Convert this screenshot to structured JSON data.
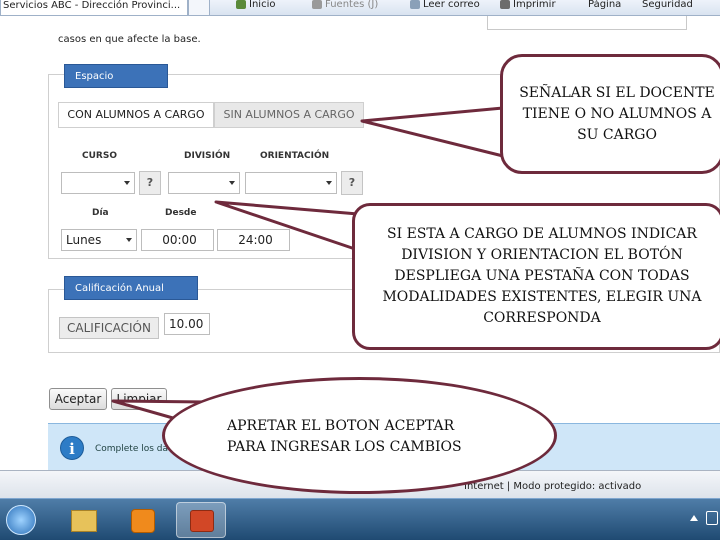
{
  "browser": {
    "tab_title": "Servicios ABC - Dirección Provinci...",
    "toolbar": {
      "home": "Inicio",
      "feeds": "Fuentes (J)",
      "read_mail": "Leer correo",
      "print": "Imprimir",
      "page": "Página",
      "safety": "Seguridad"
    }
  },
  "page": {
    "note": "casos en que afecte la base."
  },
  "academic_panel": {
    "title": "Espacio Académico:",
    "tabs": [
      "CON ALUMNOS A CARGO",
      "SIN ALUMNOS A CARGO"
    ],
    "labels": {
      "curso": "CURSO",
      "division": "DIVISIÓN",
      "orientacion": "ORIENTACIÓN",
      "dia": "Día",
      "desde": "Desde"
    },
    "help_glyph": "?",
    "dia_value": "Lunes",
    "desde_value": "00:00",
    "hasta_value": "24:00"
  },
  "rating_panel": {
    "title": "Calificación Anual Docente:",
    "label": "CALIFICACIÓN",
    "value": "10.00"
  },
  "buttons": {
    "accept": "Aceptar",
    "clean": "Limpiar"
  },
  "info_bar": {
    "text": "Complete los datos",
    "icon_glyph": "i"
  },
  "statusbar": {
    "zone": "Internet | Modo protegido: activado"
  },
  "callouts": {
    "top": "SEÑALAR SI EL DOCENTE TIENE O NO ALUMNOS A SU CARGO",
    "middle": "SI ESTA A CARGO DE ALUMNOS INDICAR DIVISION Y ORIENTACION EL BOTÓN DESPLIEGA UNA PESTAÑA CON TODAS MODALIDADES EXISTENTES, ELEGIR UNA CORRESPONDA",
    "bottom": "APRETAR EL BOTON ACEPTAR PARA INGRESAR LOS CAMBIOS"
  },
  "colors": {
    "panel_header": "#3c72b8",
    "callout_border": "#6e2a3c",
    "info_bar": "#cfe6f8",
    "taskbar": "#1f4a72"
  }
}
